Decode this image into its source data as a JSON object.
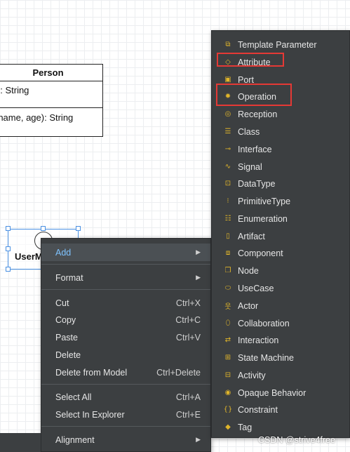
{
  "diagram": {
    "class_box": {
      "title": "Person",
      "attribute": "e: String",
      "operation": "(name, age): String"
    },
    "selected_element": {
      "label": "UserM"
    }
  },
  "context_menu": {
    "items": [
      {
        "label": "Add",
        "shortcut": "",
        "submenu": true
      },
      {
        "label": "Format",
        "shortcut": "",
        "submenu": true
      },
      {
        "label": "Cut",
        "shortcut": "Ctrl+X"
      },
      {
        "label": "Copy",
        "shortcut": "Ctrl+C"
      },
      {
        "label": "Paste",
        "shortcut": "Ctrl+V"
      },
      {
        "label": "Delete",
        "shortcut": ""
      },
      {
        "label": "Delete from Model",
        "shortcut": "Ctrl+Delete"
      },
      {
        "label": "Select All",
        "shortcut": "Ctrl+A"
      },
      {
        "label": "Select In Explorer",
        "shortcut": "Ctrl+E"
      },
      {
        "label": "Alignment",
        "shortcut": "",
        "submenu": true
      }
    ]
  },
  "add_submenu": {
    "items": [
      {
        "label": "Template Parameter",
        "icon": "template-parameter-icon"
      },
      {
        "label": "Attribute",
        "icon": "attribute-icon"
      },
      {
        "label": "Port",
        "icon": "port-icon"
      },
      {
        "label": "Operation",
        "icon": "operation-icon"
      },
      {
        "label": "Reception",
        "icon": "reception-icon"
      },
      {
        "label": "Class",
        "icon": "class-icon"
      },
      {
        "label": "Interface",
        "icon": "interface-icon"
      },
      {
        "label": "Signal",
        "icon": "signal-icon"
      },
      {
        "label": "DataType",
        "icon": "datatype-icon"
      },
      {
        "label": "PrimitiveType",
        "icon": "primitivetype-icon"
      },
      {
        "label": "Enumeration",
        "icon": "enumeration-icon"
      },
      {
        "label": "Artifact",
        "icon": "artifact-icon"
      },
      {
        "label": "Component",
        "icon": "component-icon"
      },
      {
        "label": "Node",
        "icon": "node-icon"
      },
      {
        "label": "UseCase",
        "icon": "usecase-icon"
      },
      {
        "label": "Actor",
        "icon": "actor-icon"
      },
      {
        "label": "Collaboration",
        "icon": "collaboration-icon"
      },
      {
        "label": "Interaction",
        "icon": "interaction-icon"
      },
      {
        "label": "State Machine",
        "icon": "state-machine-icon"
      },
      {
        "label": "Activity",
        "icon": "activity-icon"
      },
      {
        "label": "Opaque Behavior",
        "icon": "opaque-behavior-icon"
      },
      {
        "label": "Constraint",
        "icon": "constraint-icon"
      },
      {
        "label": "Tag",
        "icon": "tag-icon"
      }
    ]
  },
  "watermark": "CSDN @strive4free",
  "colors": {
    "menu_bg": "#3c3f41",
    "active_text": "#7fc3ff",
    "icon_color": "#e0b52a",
    "highlight_box": "#e53935"
  }
}
